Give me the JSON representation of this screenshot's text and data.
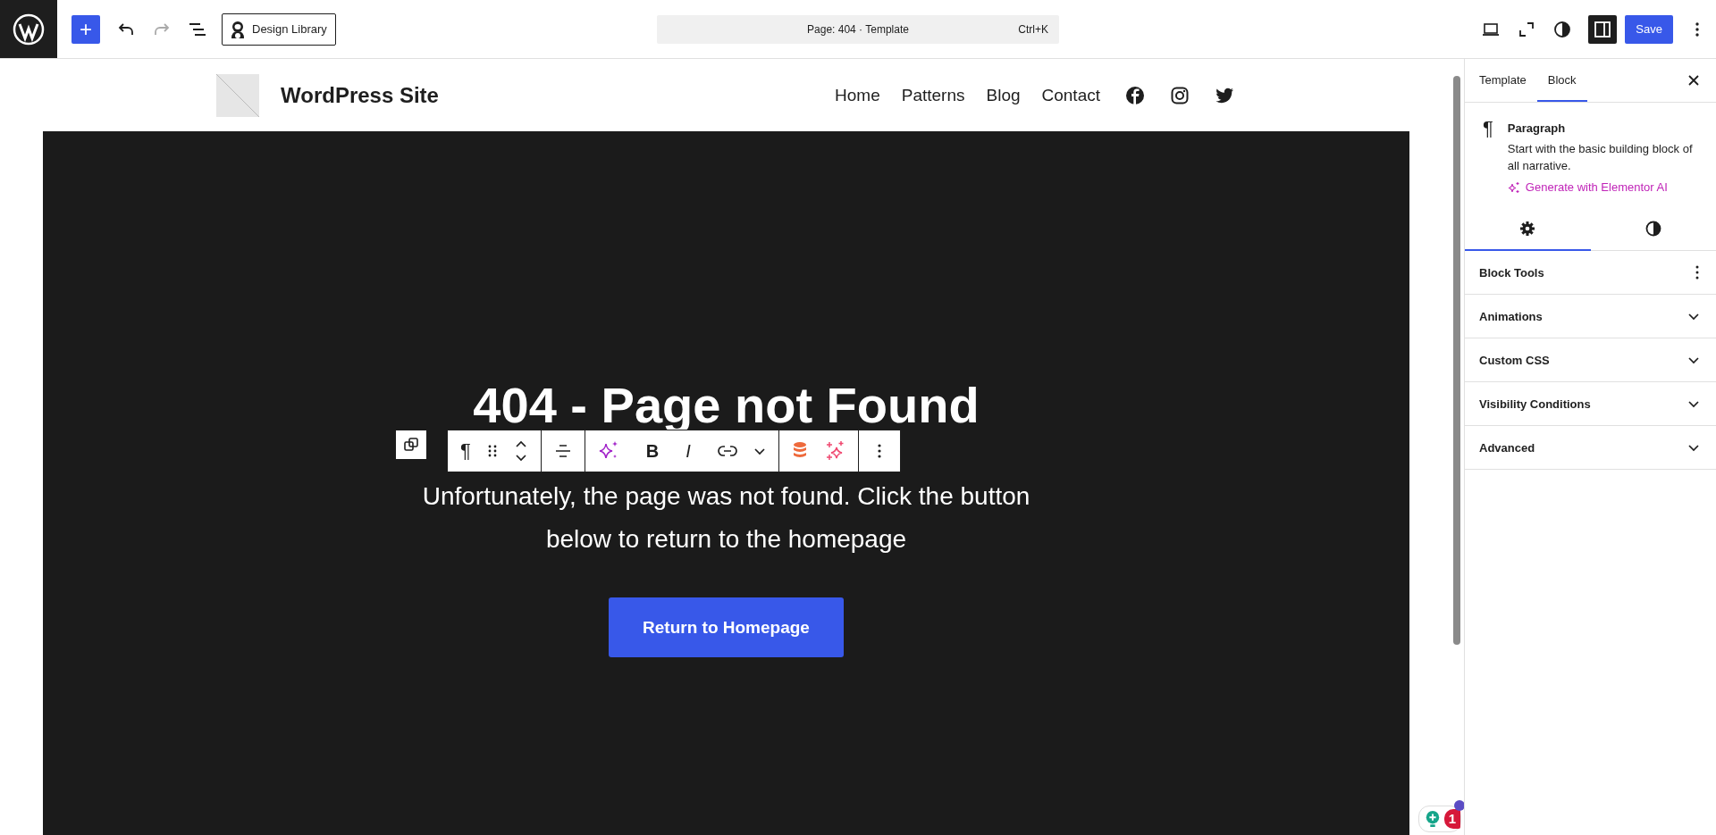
{
  "topbar": {
    "add_label": "+",
    "undo": {
      "disabled": false
    },
    "redo": {
      "disabled": true
    },
    "design_library": "Design Library",
    "command": {
      "title": "Page: 404 · Template",
      "shortcut": "Ctrl+K"
    },
    "sidebar_toggle": {
      "on": true
    },
    "save": "Save"
  },
  "site": {
    "title": "WordPress Site",
    "nav": [
      "Home",
      "Patterns",
      "Blog",
      "Contact"
    ],
    "social": [
      {
        "kind": "facebook"
      },
      {
        "kind": "instagram"
      },
      {
        "kind": "twitter"
      }
    ]
  },
  "hero": {
    "heading": "404 - Page not Found",
    "paragraph": "Unfortunately, the page was not found. Click the button below to return to the homepage",
    "button": "Return to Homepage"
  },
  "block_toolbar": {
    "paragraph_glyph": "¶",
    "bold": "B",
    "italic": "I"
  },
  "sidebar": {
    "tabs": [
      {
        "label": "Template",
        "selected": false
      },
      {
        "label": "Block",
        "selected": true
      }
    ],
    "block": {
      "glyph": "¶",
      "title": "Paragraph",
      "description": "Start with the basic building block of all narrative.",
      "ai_link": "Generate with Elementor AI"
    },
    "settings_tabs": [
      {
        "kind": "settings",
        "selected": true
      },
      {
        "kind": "styles",
        "selected": false
      }
    ],
    "panels": [
      {
        "title": "Block Tools",
        "kind": "menu"
      },
      {
        "title": "Animations",
        "kind": "collapsible",
        "expanded": false
      },
      {
        "title": "Custom CSS",
        "kind": "collapsible",
        "expanded": false
      },
      {
        "title": "Visibility Conditions",
        "kind": "collapsible",
        "expanded": false
      },
      {
        "title": "Advanced",
        "kind": "collapsible",
        "expanded": false
      }
    ]
  },
  "notification_count": "1"
}
